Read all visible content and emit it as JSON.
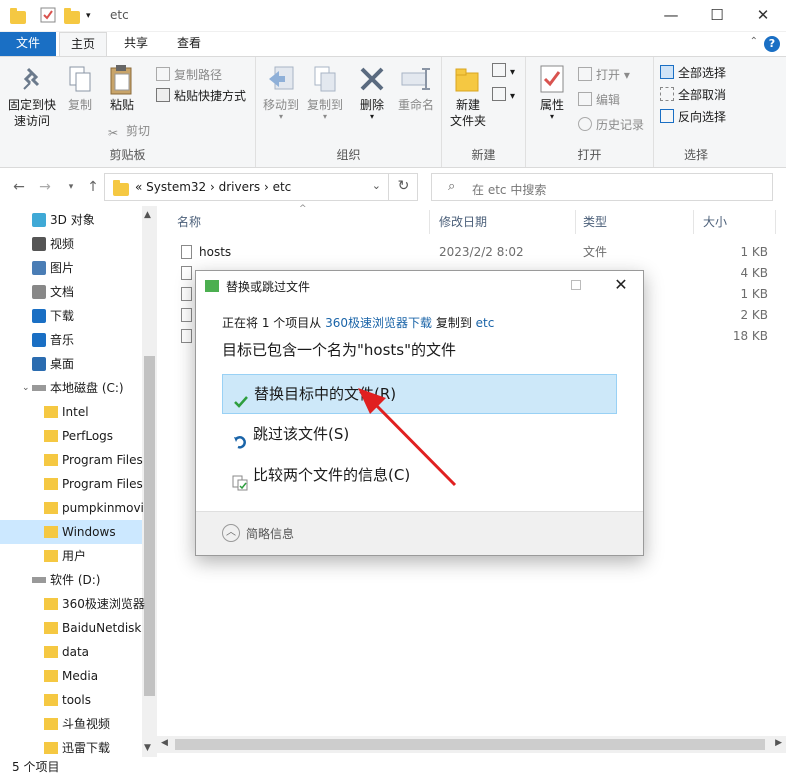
{
  "window": {
    "title": "etc",
    "buttons": {
      "minimize": "—",
      "maximize": "☐",
      "close": "✕"
    }
  },
  "ribbon_tabs": [
    "文件",
    "主页",
    "共享",
    "查看"
  ],
  "ribbon": {
    "clipboard": {
      "label": "剪贴板",
      "pin": "固定到快\n速访问",
      "copy": "复制",
      "paste": "粘贴",
      "copy_path": "复制路径",
      "paste_shortcut": "粘贴快捷方式",
      "cut": "剪切"
    },
    "organize": {
      "label": "组织",
      "move_to": "移动到",
      "copy_to": "复制到",
      "delete": "删除",
      "rename": "重命名"
    },
    "new": {
      "label": "新建",
      "new_folder": "新建\n文件夹"
    },
    "open": {
      "label": "打开",
      "properties": "属性",
      "open": "打开",
      "edit": "编辑",
      "history": "历史记录"
    },
    "select": {
      "label": "选择",
      "select_all": "全部选择",
      "select_none": "全部取消",
      "invert": "反向选择"
    }
  },
  "address": {
    "crumbs": "«  System32  ›  drivers  ›  etc",
    "search_placeholder": "在 etc 中搜索"
  },
  "sidebar": {
    "items": [
      {
        "label": "3D 对象",
        "icon": "3d-objects-icon"
      },
      {
        "label": "视频",
        "icon": "video-icon"
      },
      {
        "label": "图片",
        "icon": "pictures-icon"
      },
      {
        "label": "文档",
        "icon": "documents-icon"
      },
      {
        "label": "下载",
        "icon": "download-icon"
      },
      {
        "label": "音乐",
        "icon": "music-icon"
      },
      {
        "label": "桌面",
        "icon": "desktop-icon"
      },
      {
        "label": "本地磁盘 (C:)",
        "icon": "drive-icon"
      },
      {
        "label": "Intel",
        "icon": "folder-icon"
      },
      {
        "label": "PerfLogs",
        "icon": "folder-icon"
      },
      {
        "label": "Program Files",
        "icon": "folder-icon"
      },
      {
        "label": "Program Files",
        "icon": "folder-icon"
      },
      {
        "label": "pumpkinmovi",
        "icon": "folder-icon"
      },
      {
        "label": "Windows",
        "icon": "folder-icon"
      },
      {
        "label": "用户",
        "icon": "folder-icon"
      },
      {
        "label": "软件 (D:)",
        "icon": "drive-icon"
      },
      {
        "label": "360极速浏览器",
        "icon": "folder-icon"
      },
      {
        "label": "BaiduNetdisk",
        "icon": "folder-icon"
      },
      {
        "label": "data",
        "icon": "folder-icon"
      },
      {
        "label": "Media",
        "icon": "folder-icon"
      },
      {
        "label": "tools",
        "icon": "folder-icon"
      },
      {
        "label": "斗鱼视频",
        "icon": "folder-icon"
      },
      {
        "label": "迅雷下载",
        "icon": "folder-icon"
      }
    ]
  },
  "filelist": {
    "columns": [
      "名称",
      "修改日期",
      "类型",
      "大小"
    ],
    "rows": [
      {
        "name": "hosts",
        "date": "2023/2/2 8:02",
        "type": "文件",
        "size": "1 KB"
      },
      {
        "name": "",
        "date": "",
        "type": "",
        "size": "4 KB"
      },
      {
        "name": "",
        "date": "",
        "type": "",
        "size": "1 KB"
      },
      {
        "name": "",
        "date": "",
        "type": "",
        "size": "2 KB"
      },
      {
        "name": "",
        "date": "",
        "type": "",
        "size": "18 KB"
      }
    ]
  },
  "status": "5 个项目",
  "dialog": {
    "title": "替换或跳过文件",
    "sub_prefix": "正在将 1 个项目从 ",
    "sub_source": "360极速浏览器下载",
    "sub_mid": " 复制到 ",
    "sub_dest": "etc",
    "heading": "目标已包含一个名为\"hosts\"的文件",
    "options": [
      {
        "label": "替换目标中的文件(R)",
        "icon": "checkmark-icon"
      },
      {
        "label": "跳过该文件(S)",
        "icon": "skip-icon"
      },
      {
        "label": "比较两个文件的信息(C)",
        "icon": "compare-icon"
      }
    ],
    "footer": "简略信息"
  },
  "colors": {
    "accent": "#1a6fc4",
    "selection": "#cde8f9",
    "annotation_arrow": "#e02020"
  }
}
